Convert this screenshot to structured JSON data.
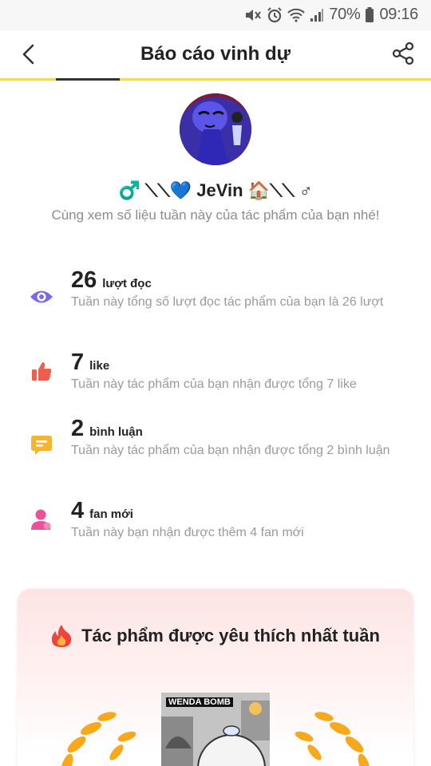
{
  "status_bar": {
    "battery": "70%",
    "time": "09:16"
  },
  "header": {
    "title": "Báo cáo vinh dự",
    "back_icon": "chevron-left-icon",
    "share_icon": "share-icon"
  },
  "author": {
    "name": "♂️ ⟍⟍💙 JeVin 🏠⟍⟍ ♂",
    "subtitle": "Cùng xem số liệu tuần này của tác phẩm của bạn nhé!"
  },
  "stats": [
    {
      "value": "26",
      "unit": "lượt đọc",
      "desc": "Tuần này tổng số lượt đọc tác phẩm của bạn là 26 lượt",
      "icon": "eye-icon",
      "color": "#7b68ee"
    },
    {
      "value": "7",
      "unit": "like",
      "desc": "Tuần này tác phẩm của bạn nhận được tổng 7 like",
      "icon": "thumbs-up-icon",
      "color": "#f25c4a"
    },
    {
      "value": "2",
      "unit": "bình luận",
      "desc": "Tuần này tác phẩm của bạn nhận được tổng 2 bình luận",
      "icon": "comment-icon",
      "color": "#f5b432"
    },
    {
      "value": "4",
      "unit": "fan mới",
      "desc": "Tuần này bạn nhận được thêm 4 fan mới",
      "icon": "user-icon",
      "color": "#f0509a"
    }
  ],
  "favorite_card": {
    "title": "Tác phẩm được yêu thích nhất tuần",
    "cover_text": "WENDA BOMB",
    "icon": "fire-icon"
  }
}
